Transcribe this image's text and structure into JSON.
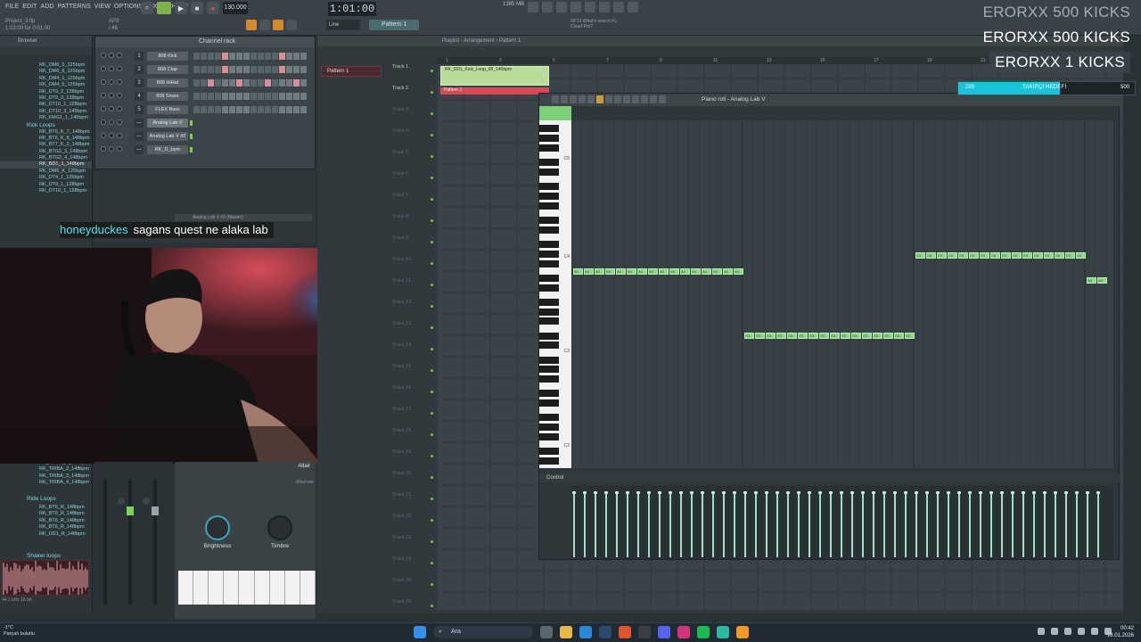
{
  "menu": {
    "items": [
      "File",
      "Edit",
      "Add",
      "Patterns",
      "View",
      "Options",
      "Tools",
      "Help"
    ],
    "project_name": "Project_3.flp",
    "project_time": "1:02:00 for 0:01:00",
    "counter": "AP3 / 46"
  },
  "transport": {
    "tempo": "130.000",
    "time": "1:01:00",
    "pattern": "Pattern 1",
    "snap": "Line",
    "cpu": "1385 MB",
    "news_line1": "What's new in FL",
    "news_line2": "Cloud Pro?",
    "news_time": "09:12"
  },
  "overlay": {
    "kick_line_1": "ERORXX  500 KICKS",
    "kick_line_2": "ERORXX  500 KICKS",
    "kick_line_3": "ERORXX  1 KICKS",
    "goal_current": "289",
    "goal_label": "TAKİPÇİ HEDEFİ",
    "goal_max": "500",
    "goal_fraction": 0.578
  },
  "browser": {
    "title": "Browser",
    "files_top": [
      "RK_DM6_3_125bpm",
      "RK_DM6_6_125bpm",
      "RK_DM4_1_125bpm",
      "RK_DM4_5_125bpm",
      "RK_DT9_2_128bpm",
      "RK_DT9_3_128bpm",
      "RK_DT10_1_128bpm",
      "RK_DT10_3_145bpm",
      "RK_FMG1_1_145bpm"
    ],
    "folder_kick": "Kick Loops",
    "files_kick": [
      "RK_BT6_K_7_148bpm",
      "RK_BT6_K_8_148bpm",
      "RK_BT7_K_2_148bpm",
      "RK_BTG2_3_148bpm",
      "RK_BTG2_4_148bpm",
      "RK_BD1_1_148bpm",
      "RK_DM6_K_125bpm",
      "RK_DT4_1_125bpm",
      "RK_DT9_1_128bpm",
      "RK_DT10_1_128bpm"
    ],
    "selected_index": 5,
    "files_lower": [
      "RK_TRIBA_1_148bpm",
      "RK_TRIBA_2_148bpm",
      "RK_TRIBA_3_148bpm",
      "RK_TRIBA_4_148bpm"
    ],
    "folder_ride": "Ride Loops",
    "files_ride": [
      "RK_BT6_R_148bpm",
      "RK_BT6_R_148bpm",
      "RK_BT6_R_148bpm",
      "RK_BT6_R_148bpm",
      "RK_DD1_R_148bpm"
    ],
    "folder_shaker": "Shaker loops",
    "footer": "44.1 kHz 16 bit"
  },
  "channel_rack": {
    "title": "Channel rack",
    "channels": [
      {
        "num": "1",
        "name": "808 Kick"
      },
      {
        "num": "2",
        "name": "808 Clap"
      },
      {
        "num": "3",
        "name": "808 HiHat"
      },
      {
        "num": "4",
        "name": "808 Snare"
      },
      {
        "num": "5",
        "name": "FLEX Bass"
      },
      {
        "num": "---",
        "name": "Analog Lab V"
      },
      {
        "num": "---",
        "name": "Analog Lab V #2"
      },
      {
        "num": "---",
        "name": "RK_D_bpm"
      }
    ]
  },
  "chat": {
    "user": "honeyduckes",
    "message": "sagans quest ne alaka lab"
  },
  "plugin": {
    "sampler_tab": "Analog Lab V #2 (Master)",
    "name": "Altair",
    "sub": "Alternate",
    "knob1": "Brightness",
    "knob2": "Timbre"
  },
  "playlist": {
    "header": "Playlist - Arrangement › Pattern 1",
    "pattern_item": "Pattern 1",
    "tracks": [
      "Track 1",
      "Track 2",
      "Track 3",
      "Track 4",
      "Track 5",
      "Track 6",
      "Track 7",
      "Track 8",
      "Track 9",
      "Track 10",
      "Track 11",
      "Track 12",
      "Track 13",
      "Track 14",
      "Track 15",
      "Track 16",
      "Track 17",
      "Track 18",
      "Track 19",
      "Track 20",
      "Track 21",
      "Track 22",
      "Track 23",
      "Track 24",
      "Track 25",
      "Track 26"
    ],
    "ruler": [
      "1",
      "3",
      "5",
      "7",
      "9",
      "11",
      "13",
      "15",
      "17",
      "19",
      "21"
    ],
    "clip1": "RK_DD1_Kick_Loop_08_145bpm",
    "clip2": "Pattern 1"
  },
  "piano_roll": {
    "title": "Piano roll - Analog Lab V",
    "octaves": [
      "C5",
      "C4",
      "C3",
      "C2"
    ],
    "control_label": "Control",
    "note_label_a": "A4",
    "note_label_b": "G3",
    "note_label_c": "C4"
  },
  "taskbar": {
    "weather_temp": "-1°C",
    "weather_desc": "Parçalı bulutlu",
    "search": "Ara",
    "time": "00:42",
    "date": "18.01.2026"
  },
  "colors": {
    "accent_cyan": "#19c3da",
    "note_green": "#8fd889",
    "step_pink": "#d78e97"
  }
}
